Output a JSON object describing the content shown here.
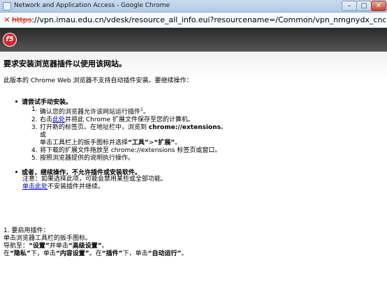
{
  "window": {
    "title": "Network and Application Access - Google Chrome",
    "minimize_glyph": "–",
    "maximize_glyph": "□",
    "close_glyph": "✕"
  },
  "address": {
    "scheme": "https",
    "rest": "://vpn.imau.edu.cn/vdesk/resource_all_info.eui?resourcename=/Common/vpn_nmgnydx_cnc_na_res&"
  },
  "page": {
    "logo_text": "f5",
    "heading": "要求安装浏览器插件以使用该网站。",
    "intro": "此版本的 Chrome Web 浏览器不支持自动插件安装。要继续操作：",
    "manual_install": {
      "title": "请尝试手动安装。",
      "steps": [
        {
          "num": "1.",
          "text": "确认您的浏览器允许该网站运行插件",
          "sup": "1",
          "suffix": "。"
        },
        {
          "num": "2.",
          "pre": "右击",
          "link": "此处",
          "post": "并将此 Chrome 扩展文件保存至您的计算机。"
        },
        {
          "num": "3.",
          "pre": "打开新的标签页。在地址栏中，浏览到 ",
          "bold": "chrome://extensions",
          "post": "。",
          "or": "或",
          "alt_pre": "单击工具栏上的扳手图标并选择",
          "alt_b1": "“工具”",
          "alt_mid": ">",
          "alt_b2": "“扩展”",
          "alt_post": "。"
        },
        {
          "num": "4.",
          "text": "将下载的扩展文件拖放至 chrome://extensions 标签页或窗口。"
        },
        {
          "num": "5.",
          "text": "按照浏览器提供的说明执行操作。"
        }
      ]
    },
    "alternative": {
      "title": "或者，继续操作，不允许插件或安装软件。",
      "note": "注意：如果选择此项，可能会禁用某些或全部功能。",
      "link_text": "单击此处",
      "link_suffix": "不安装插件并继续。"
    },
    "footnote": {
      "line1": "1. 要启用插件：",
      "line2": "单击浏览器工具栏的扳手图标。",
      "line3_pre": "导航至：",
      "line3_b1": "“设置”",
      "line3_mid": "并单击",
      "line3_b2": "“高级设置”",
      "line3_post": "。",
      "line4_pre": "在",
      "line4_b1": "“隐私”",
      "line4_mid1": "下，单击",
      "line4_b2": "“内容设置”",
      "line4_mid2": "。在",
      "line4_b3": "“插件”",
      "line4_mid3": "下，单击",
      "line4_b4": "“自动运行”",
      "line4_post": "。"
    }
  }
}
